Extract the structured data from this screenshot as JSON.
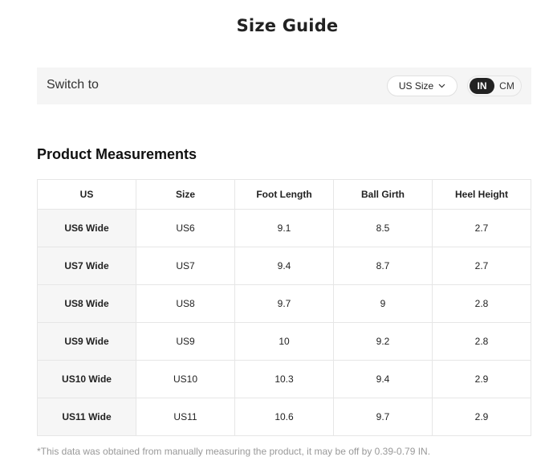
{
  "title": "Size Guide",
  "switch": {
    "label": "Switch to",
    "size_select": "US Size",
    "units": [
      {
        "label": "IN",
        "active": true
      },
      {
        "label": "CM",
        "active": false
      }
    ]
  },
  "section_title": "Product Measurements",
  "table": {
    "headers": [
      "US",
      "Size",
      "Foot Length",
      "Ball Girth",
      "Heel Height"
    ],
    "rows": [
      [
        "US6 Wide",
        "US6",
        "9.1",
        "8.5",
        "2.7"
      ],
      [
        "US7 Wide",
        "US7",
        "9.4",
        "8.7",
        "2.7"
      ],
      [
        "US8 Wide",
        "US8",
        "9.7",
        "9",
        "2.8"
      ],
      [
        "US9 Wide",
        "US9",
        "10",
        "9.2",
        "2.8"
      ],
      [
        "US10 Wide",
        "US10",
        "10.3",
        "9.4",
        "2.9"
      ],
      [
        "US11 Wide",
        "US11",
        "10.6",
        "9.7",
        "2.9"
      ]
    ]
  },
  "footnote": "*This data was obtained from manually measuring the product, it may be off by 0.39-0.79 IN."
}
